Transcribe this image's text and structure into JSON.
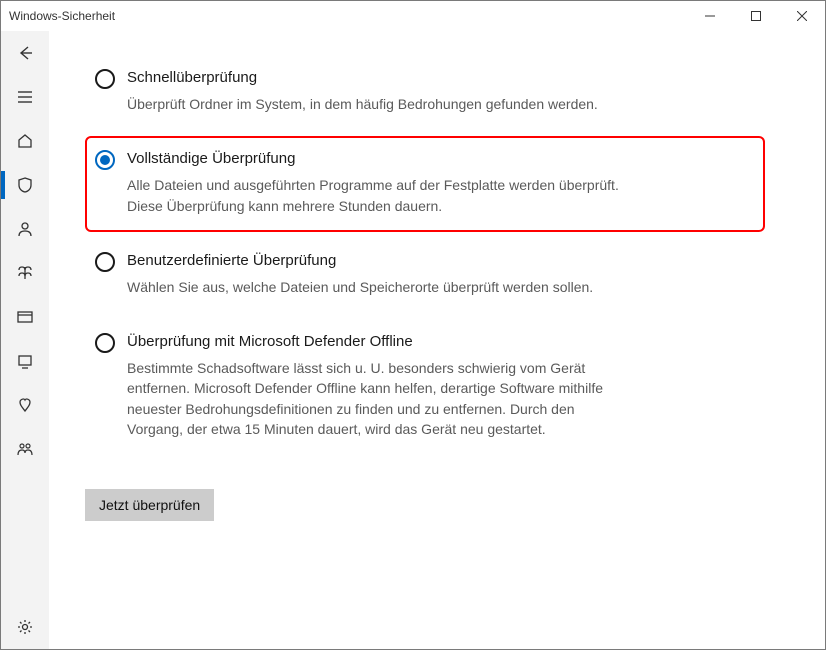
{
  "window": {
    "title": "Windows-Sicherheit"
  },
  "sidebar": {
    "items": [
      {
        "name": "back-button"
      },
      {
        "name": "menu-button"
      },
      {
        "name": "home"
      },
      {
        "name": "virus-protection",
        "active": true
      },
      {
        "name": "account-protection"
      },
      {
        "name": "firewall-network"
      },
      {
        "name": "app-browser-control"
      },
      {
        "name": "device-security"
      },
      {
        "name": "device-performance"
      },
      {
        "name": "family-options"
      }
    ],
    "bottom": {
      "name": "settings"
    }
  },
  "scanOptions": [
    {
      "id": "quick",
      "title": "Schnellüberprüfung",
      "desc": "Überprüft Ordner im System, in dem häufig Bedrohungen gefunden werden.",
      "selected": false,
      "highlight": false
    },
    {
      "id": "full",
      "title": "Vollständige Überprüfung",
      "desc": "Alle Dateien und ausgeführten Programme auf der Festplatte werden überprüft. Diese Überprüfung kann mehrere Stunden dauern.",
      "selected": true,
      "highlight": true
    },
    {
      "id": "custom",
      "title": "Benutzerdefinierte Überprüfung",
      "desc": "Wählen Sie aus, welche Dateien und Speicherorte überprüft werden sollen.",
      "selected": false,
      "highlight": false
    },
    {
      "id": "offline",
      "title": "Überprüfung mit Microsoft Defender Offline",
      "desc": "Bestimmte Schadsoftware lässt sich u. U. besonders schwierig vom Gerät entfernen. Microsoft Defender Offline kann helfen, derartige Software mithilfe neuester Bedrohungsdefinitionen zu finden und zu entfernen. Durch den Vorgang, der etwa 15 Minuten dauert, wird das Gerät neu gestartet.",
      "selected": false,
      "highlight": false
    }
  ],
  "actions": {
    "scanNow": "Jetzt überprüfen"
  }
}
